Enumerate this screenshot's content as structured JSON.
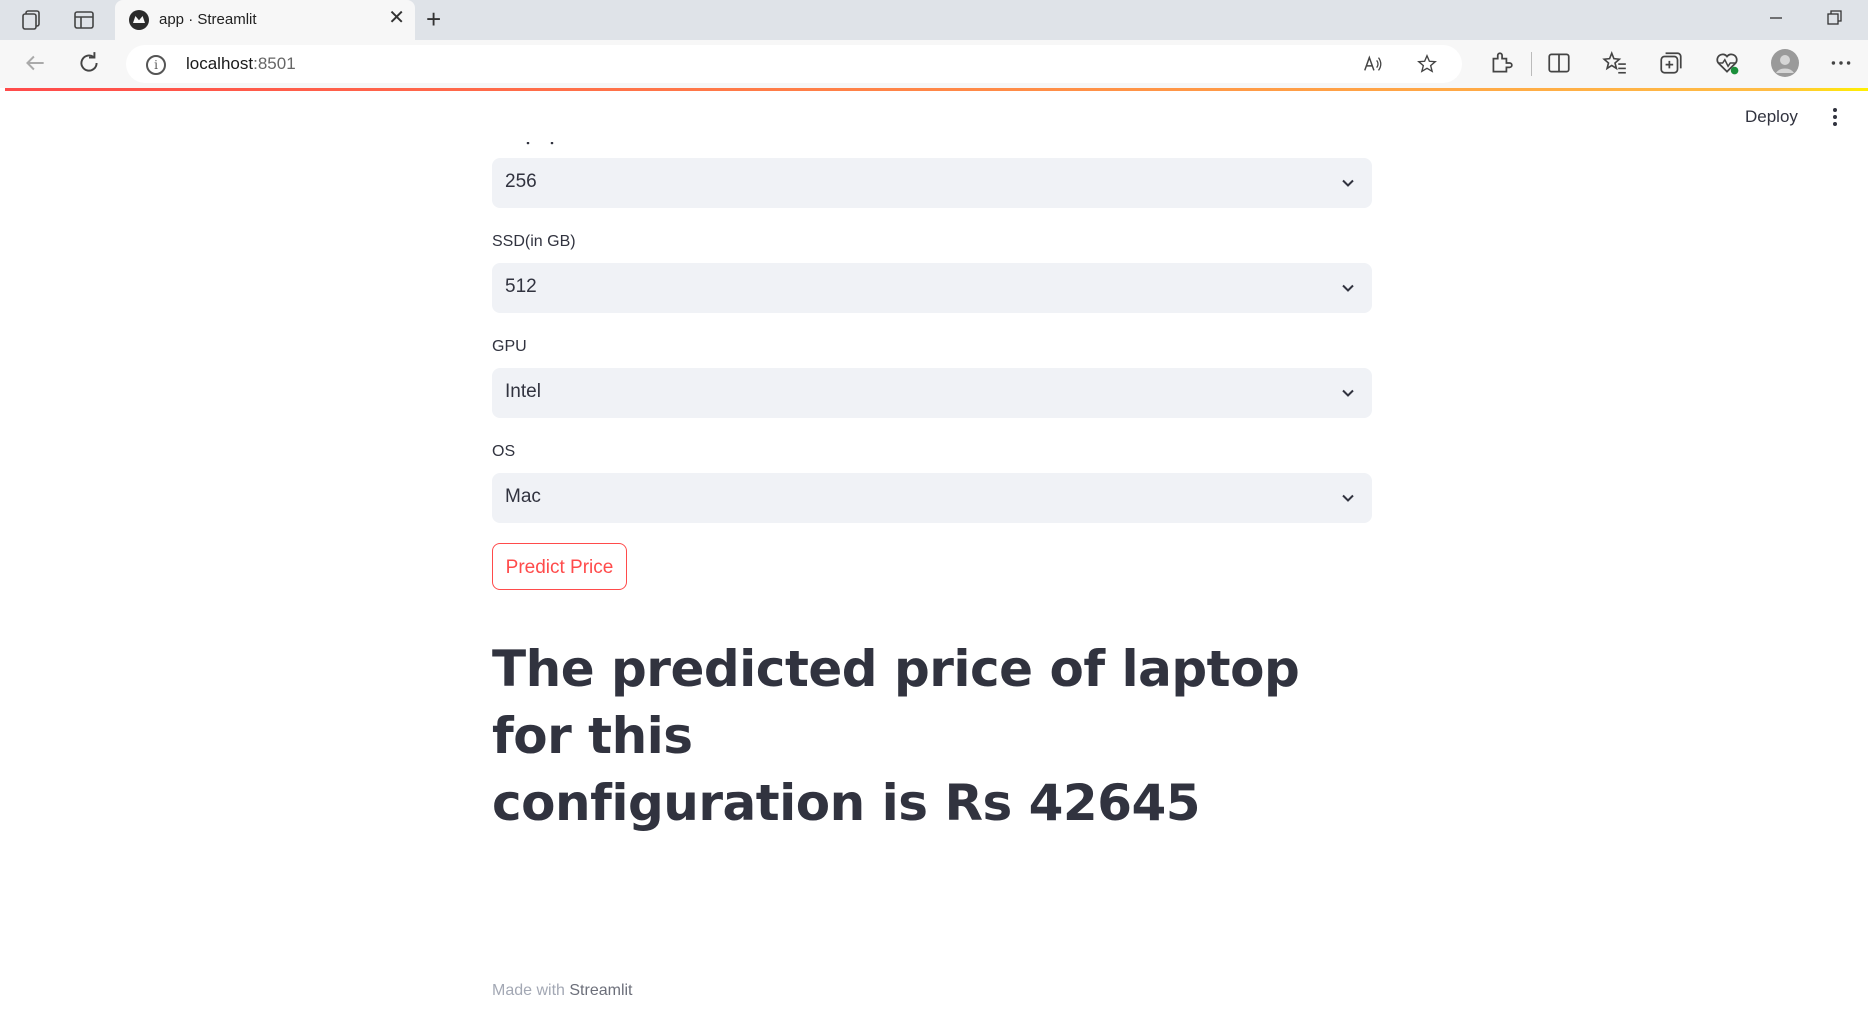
{
  "browser": {
    "tab_title": "app · Streamlit",
    "close_glyph": "✕",
    "new_tab_glyph": "+",
    "url_host": "localhost",
    "url_port": ":8501"
  },
  "header": {
    "deploy_label": "Deploy"
  },
  "form": {
    "hdd": {
      "value": "256"
    },
    "ssd": {
      "label": "SSD(in GB)",
      "value": "512"
    },
    "gpu": {
      "label": "GPU",
      "value": "Intel"
    },
    "os": {
      "label": "OS",
      "value": "Mac"
    },
    "predict_button": "Predict Price"
  },
  "result": {
    "line1": "The predicted price of laptop for this",
    "line2": "configuration is Rs 42645"
  },
  "footer": {
    "prefix": "Made with ",
    "brand": "Streamlit"
  },
  "colors": {
    "accent": "#ff4b4b",
    "text": "#31333f",
    "select_bg": "#f0f2f6"
  }
}
